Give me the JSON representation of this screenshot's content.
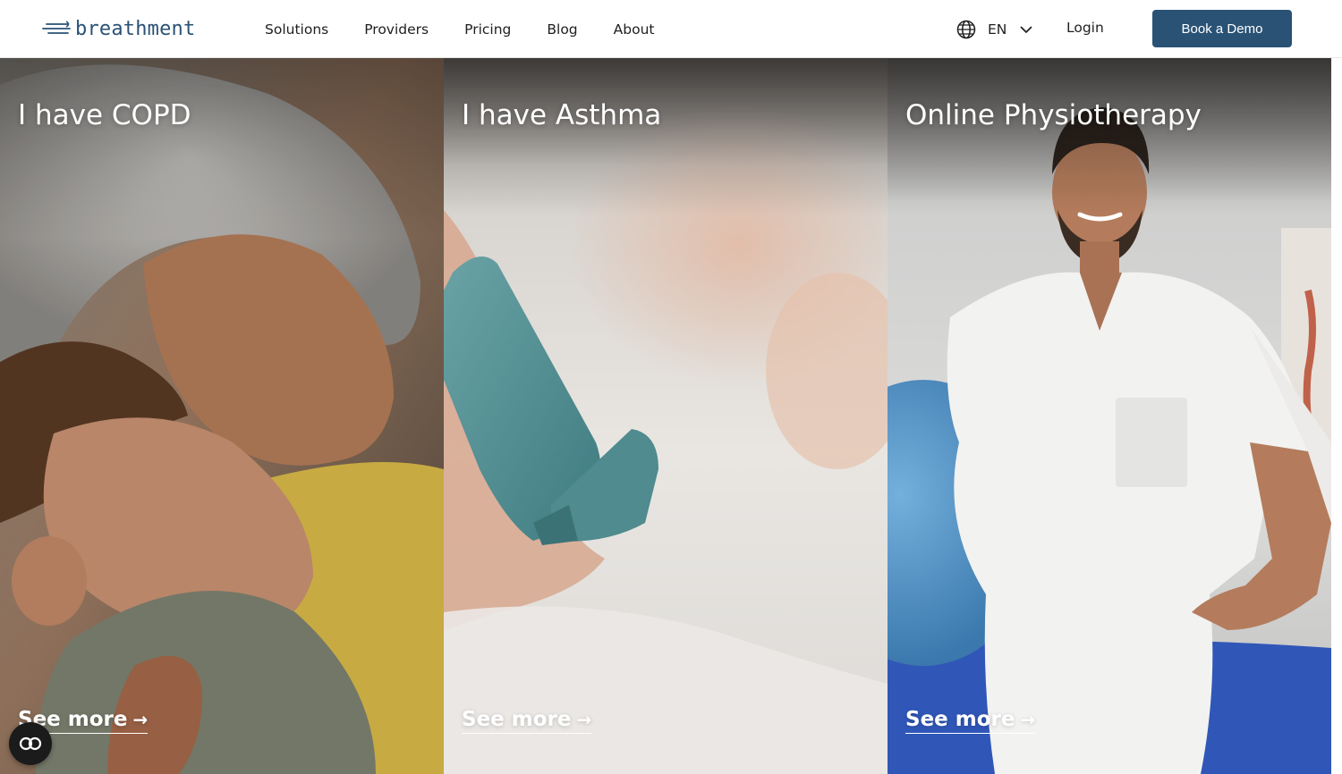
{
  "header": {
    "brand": "breathment",
    "nav": [
      "Solutions",
      "Providers",
      "Pricing",
      "Blog",
      "About"
    ],
    "language": "EN",
    "login_label": "Login",
    "demo_label": "Book a Demo"
  },
  "panels": [
    {
      "title": "I have COPD",
      "link_label": "See more",
      "link_arrow": "→"
    },
    {
      "title": "I have Asthma",
      "link_label": "See more",
      "link_arrow": "→"
    },
    {
      "title": "Online Physiotherapy",
      "link_label": "See more",
      "link_arrow": "→"
    }
  ],
  "colors": {
    "brand": "#2a5275",
    "text": "#1f1f1f",
    "overlay_text": "#ffffff"
  },
  "icons": {
    "language": "globe-icon",
    "dropdown": "chevron-down-icon",
    "link": "arrow-right-icon",
    "accessibility": "accessibility-icon"
  }
}
